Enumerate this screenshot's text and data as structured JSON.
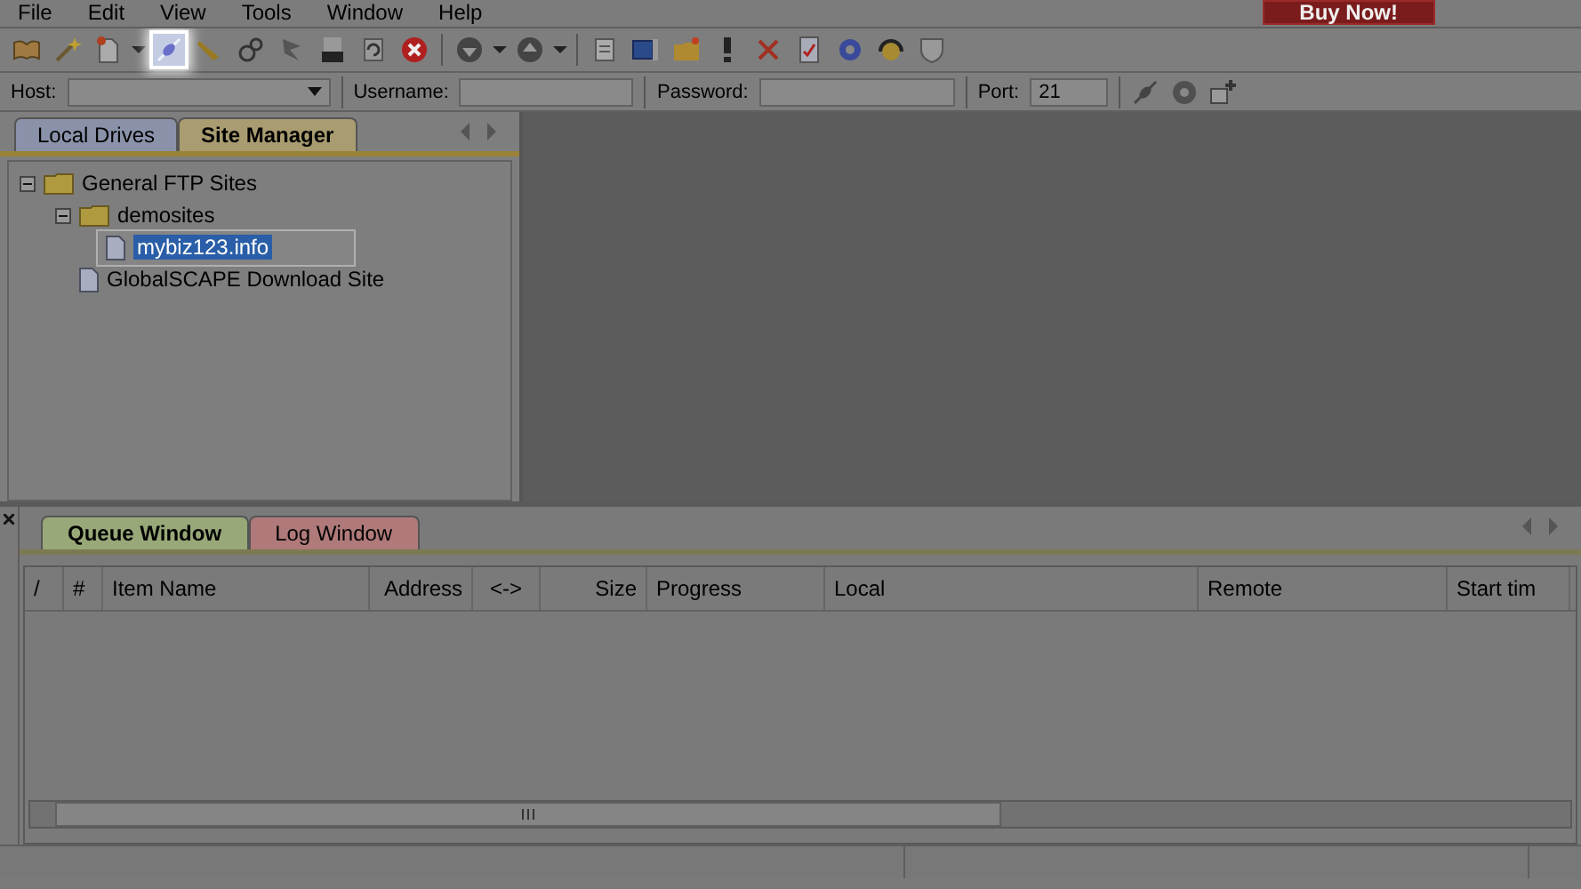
{
  "menu": [
    {
      "label": "File"
    },
    {
      "label": "Edit"
    },
    {
      "label": "View"
    },
    {
      "label": "Tools"
    },
    {
      "label": "Window"
    },
    {
      "label": "Help"
    }
  ],
  "buy_button": {
    "label": "Buy Now!"
  },
  "toolbar_groups": [
    {
      "items": [
        {
          "kind": "book",
          "selected": false
        },
        {
          "kind": "wand",
          "selected": false
        },
        {
          "kind": "newfile",
          "selected": false
        },
        {
          "kind": "caret",
          "selected": false
        },
        {
          "kind": "plug",
          "selected": true
        },
        {
          "kind": "pen",
          "selected": false
        },
        {
          "kind": "gears",
          "selected": false
        },
        {
          "kind": "flag",
          "selected": false
        },
        {
          "kind": "url",
          "selected": false
        },
        {
          "kind": "refresh",
          "selected": false
        },
        {
          "kind": "stop",
          "selected": false
        }
      ]
    },
    {
      "items": [
        {
          "kind": "down",
          "selected": false
        },
        {
          "kind": "caret",
          "selected": false
        },
        {
          "kind": "up",
          "selected": false
        },
        {
          "kind": "caret",
          "selected": false
        }
      ]
    },
    {
      "items": [
        {
          "kind": "note",
          "selected": false
        },
        {
          "kind": "window",
          "selected": false
        },
        {
          "kind": "folder",
          "selected": false
        },
        {
          "kind": "exclaim",
          "selected": false
        },
        {
          "kind": "cross",
          "selected": false
        },
        {
          "kind": "checkdoc",
          "selected": false
        },
        {
          "kind": "gear",
          "selected": false
        },
        {
          "kind": "headset",
          "selected": false
        },
        {
          "kind": "shield",
          "selected": false
        }
      ]
    }
  ],
  "connection": {
    "host": {
      "label": "Host:"
    },
    "username": {
      "label": "Username:"
    },
    "password": {
      "label": "Password:"
    },
    "port": {
      "label": "Port:",
      "value": "21"
    }
  },
  "left_tabs": [
    {
      "label": "Local Drives",
      "selected": false
    },
    {
      "label": "Site Manager",
      "selected": true
    }
  ],
  "tree": [
    {
      "label": "General FTP Sites",
      "kind": "folder",
      "expanded": true,
      "children": [
        {
          "label": "demosites",
          "kind": "folder",
          "expanded": true,
          "children": [
            {
              "label": "mybiz123.info",
              "kind": "site",
              "editing": true
            }
          ]
        },
        {
          "label": "GlobalSCAPE Download Site",
          "kind": "site",
          "editing": false
        }
      ]
    }
  ],
  "bottom_tabs": [
    {
      "label": "Queue Window",
      "selected": true
    },
    {
      "label": "Log Window",
      "selected": false
    }
  ],
  "queue_columns": [
    {
      "label": "/"
    },
    {
      "label": "#"
    },
    {
      "label": "Item Name"
    },
    {
      "label": "Address"
    },
    {
      "label": "<->"
    },
    {
      "label": "Size"
    },
    {
      "label": "Progress"
    },
    {
      "label": "Local"
    },
    {
      "label": "Remote"
    },
    {
      "label": "Start tim"
    }
  ]
}
